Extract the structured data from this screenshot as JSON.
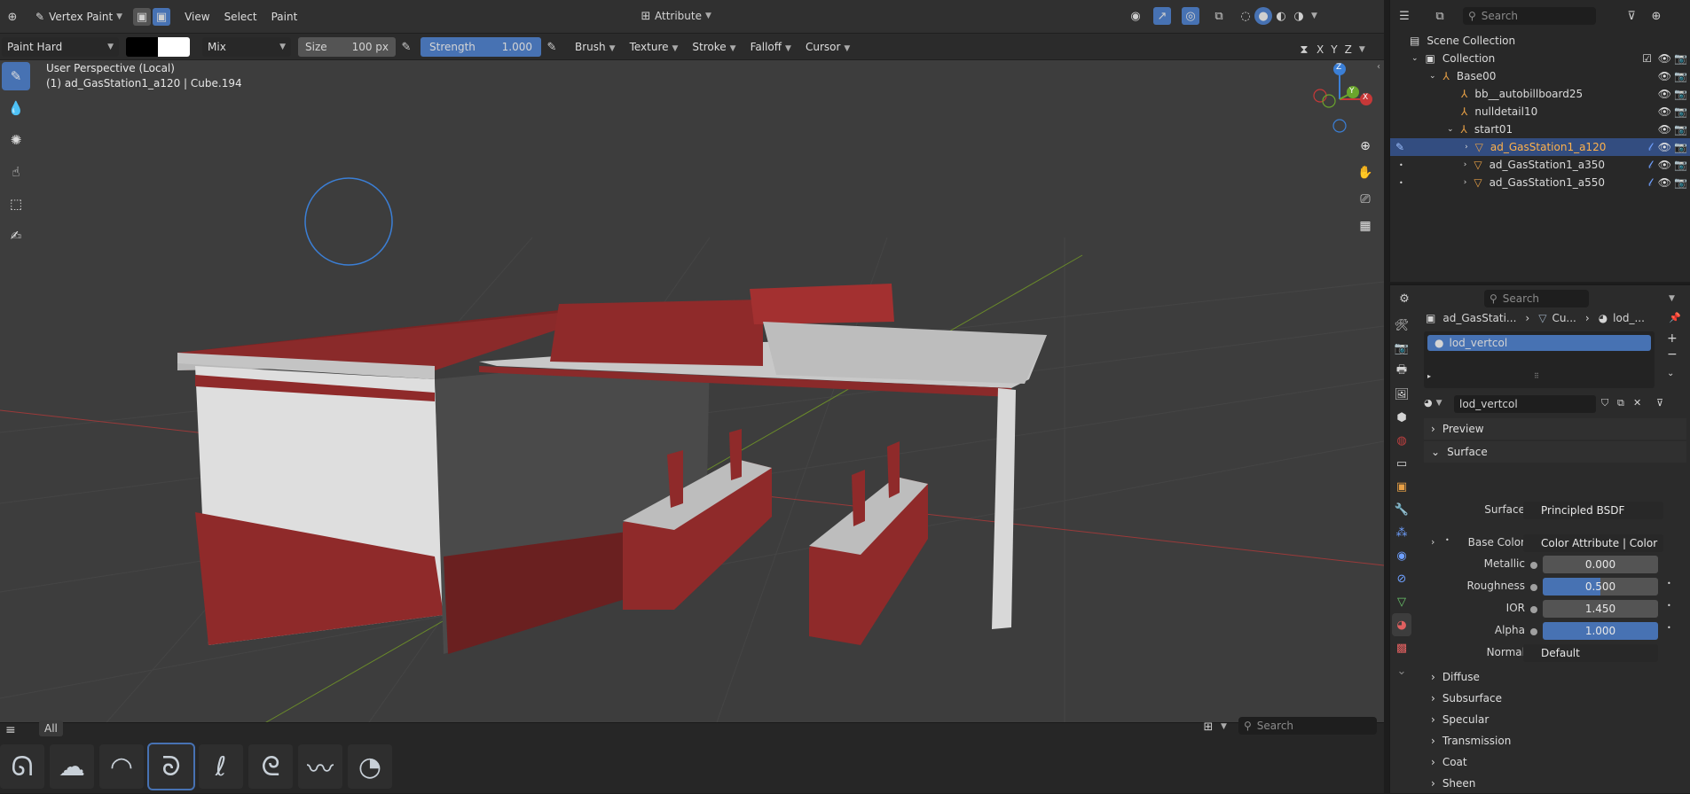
{
  "header": {
    "mode": "Vertex Paint",
    "menus": [
      "View",
      "Select",
      "Paint"
    ],
    "attribute": "Attribute"
  },
  "tool_options": {
    "brush": "Paint Hard",
    "blend": "Mix",
    "size_label": "Size",
    "size_value": "100 px",
    "strength_label": "Strength",
    "strength_value": "1.000",
    "menus": [
      "Brush",
      "Texture",
      "Stroke",
      "Falloff",
      "Cursor"
    ],
    "axes": [
      "X",
      "Y",
      "Z"
    ]
  },
  "viewport": {
    "perspective": "User Perspective (Local)",
    "object_info": "(1) ad_GasStation1_a120 | Cube.194",
    "gizmo": {
      "x": "X",
      "y": "Y",
      "z": "Z"
    }
  },
  "shelf": {
    "tab": "All",
    "search_placeholder": "Search",
    "brush_icons": [
      "paint-hard-brush",
      "airbrush",
      "blur-brush",
      "paint-hard-pressure-brush",
      "paint-soft-brush",
      "paint-blend-brush",
      "paint-smear-brush",
      "paint-soft-pressure-brush"
    ]
  },
  "outliner": {
    "search_placeholder": "Search",
    "items": [
      {
        "label": "Scene Collection",
        "depth": 0
      },
      {
        "label": "Collection",
        "depth": 1
      },
      {
        "label": "Base00",
        "depth": 2
      },
      {
        "label": "bb__autobillboard25",
        "depth": 3
      },
      {
        "label": "nulldetail10",
        "depth": 3
      },
      {
        "label": "start01",
        "depth": 3
      },
      {
        "label": "ad_GasStation1_a120",
        "depth": 4,
        "selected": true
      },
      {
        "label": "ad_GasStation1_a350",
        "depth": 4
      },
      {
        "label": "ad_GasStation1_a550",
        "depth": 4
      }
    ]
  },
  "properties": {
    "search_placeholder": "Search",
    "breadcrumb": [
      "ad_GasStati...",
      "Cu...",
      "lod_..."
    ],
    "material_slot": "lod_vertcol",
    "material_name": "lod_vertcol",
    "panels": {
      "preview": "Preview",
      "surface": "Surface",
      "diffuse": "Diffuse",
      "subsurface": "Subsurface",
      "specular": "Specular",
      "transmission": "Transmission",
      "coat": "Coat",
      "sheen": "Sheen"
    },
    "fields": {
      "surface_label": "Surface",
      "surface_value": "Principled BSDF",
      "base_color_label": "Base Color",
      "base_color_value": "Color Attribute | Color",
      "metallic_label": "Metallic",
      "metallic_value": "0.000",
      "roughness_label": "Roughness",
      "roughness_value": "0.500",
      "ior_label": "IOR",
      "ior_value": "1.450",
      "alpha_label": "Alpha",
      "alpha_value": "1.000",
      "normal_label": "Normal",
      "normal_value": "Default"
    }
  },
  "colors": {
    "accent": "#4772b3",
    "selected_object": "#e8a046",
    "building_red": "#8f2a2a",
    "viewport_bg": "#3d3d3d"
  }
}
